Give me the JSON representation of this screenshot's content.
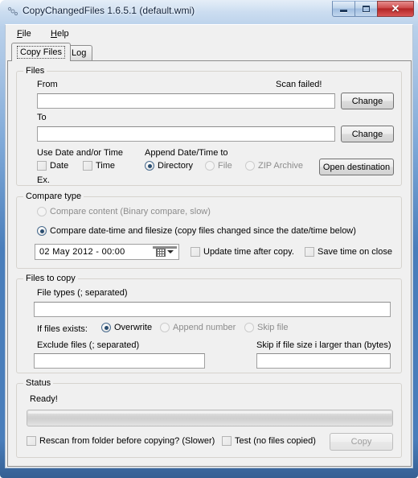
{
  "window": {
    "title": "CopyChangedFiles 1.6.5.1 (default.wmi)",
    "icon": "app-icon",
    "controls": {
      "minimize": "minimize",
      "maximize": "maximize",
      "close": "✕"
    }
  },
  "menu": {
    "items": [
      {
        "label": "File",
        "accel": "F",
        "rest": "ile"
      },
      {
        "label": "Help",
        "accel": "H",
        "rest": "elp"
      }
    ]
  },
  "tabs": [
    {
      "label": "Copy Files",
      "active": true
    },
    {
      "label": "Log",
      "active": false
    }
  ],
  "files_group": {
    "legend": "Files",
    "from_label": "From",
    "from_value": "",
    "from_placeholder": "",
    "scan_status": "Scan failed!",
    "to_label": "To",
    "to_value": "",
    "to_placeholder": "",
    "change_from_label": "Change",
    "change_to_label": "Change",
    "use_datetime_label": "Use Date and/or Time",
    "date_checkbox_label": "Date",
    "date_checked": false,
    "time_checkbox_label": "Time",
    "time_checked": false,
    "example_label": "Ex.",
    "append_label": "Append Date/Time to",
    "append_options": [
      {
        "label": "Directory",
        "selected": true,
        "disabled": false
      },
      {
        "label": "File",
        "selected": false,
        "disabled": true
      },
      {
        "label": "ZIP Archive",
        "selected": false,
        "disabled": true
      }
    ],
    "open_destination_label": "Open destination"
  },
  "compare_group": {
    "legend": "Compare type",
    "options": [
      {
        "label": "Compare content (Binary compare, slow)",
        "selected": false,
        "disabled": true
      },
      {
        "label": "Compare date-time and filesize (copy files changed since the date/time below)",
        "selected": true,
        "disabled": false
      }
    ],
    "date_value": "02   May   2012   -   00:00",
    "update_time_label": "Update time after copy.",
    "update_time_checked": false,
    "save_time_label": "Save time on close",
    "save_time_checked": false
  },
  "filestocopy_group": {
    "legend": "Files to copy",
    "file_types_label": "File types (; separated)",
    "file_types_value": "",
    "if_exists_label": "If files exists:",
    "if_exists_options": [
      {
        "label": "Overwrite",
        "selected": true,
        "disabled": false
      },
      {
        "label": "Append number",
        "selected": false,
        "disabled": true
      },
      {
        "label": "Skip file",
        "selected": false,
        "disabled": true
      }
    ],
    "exclude_label": "Exclude files (; separated)",
    "exclude_value": "",
    "skip_size_label": "Skip if file size i larger than (bytes)",
    "skip_size_value": ""
  },
  "status_group": {
    "legend": "Status",
    "status_text": "Ready!",
    "progress_percent": 0,
    "rescan_label": "Rescan from folder before copying? (Slower)",
    "rescan_checked": false,
    "test_label": "Test (no files copied)",
    "test_checked": false,
    "copy_button_label": "Copy",
    "copy_button_disabled": true
  },
  "colors": {
    "frame_blue": "#4a7ebb",
    "client_bg": "#f0f0f0",
    "close_red": "#b32626",
    "radio_dot": "#2a4d70",
    "disabled_text": "#8c8c8c"
  }
}
